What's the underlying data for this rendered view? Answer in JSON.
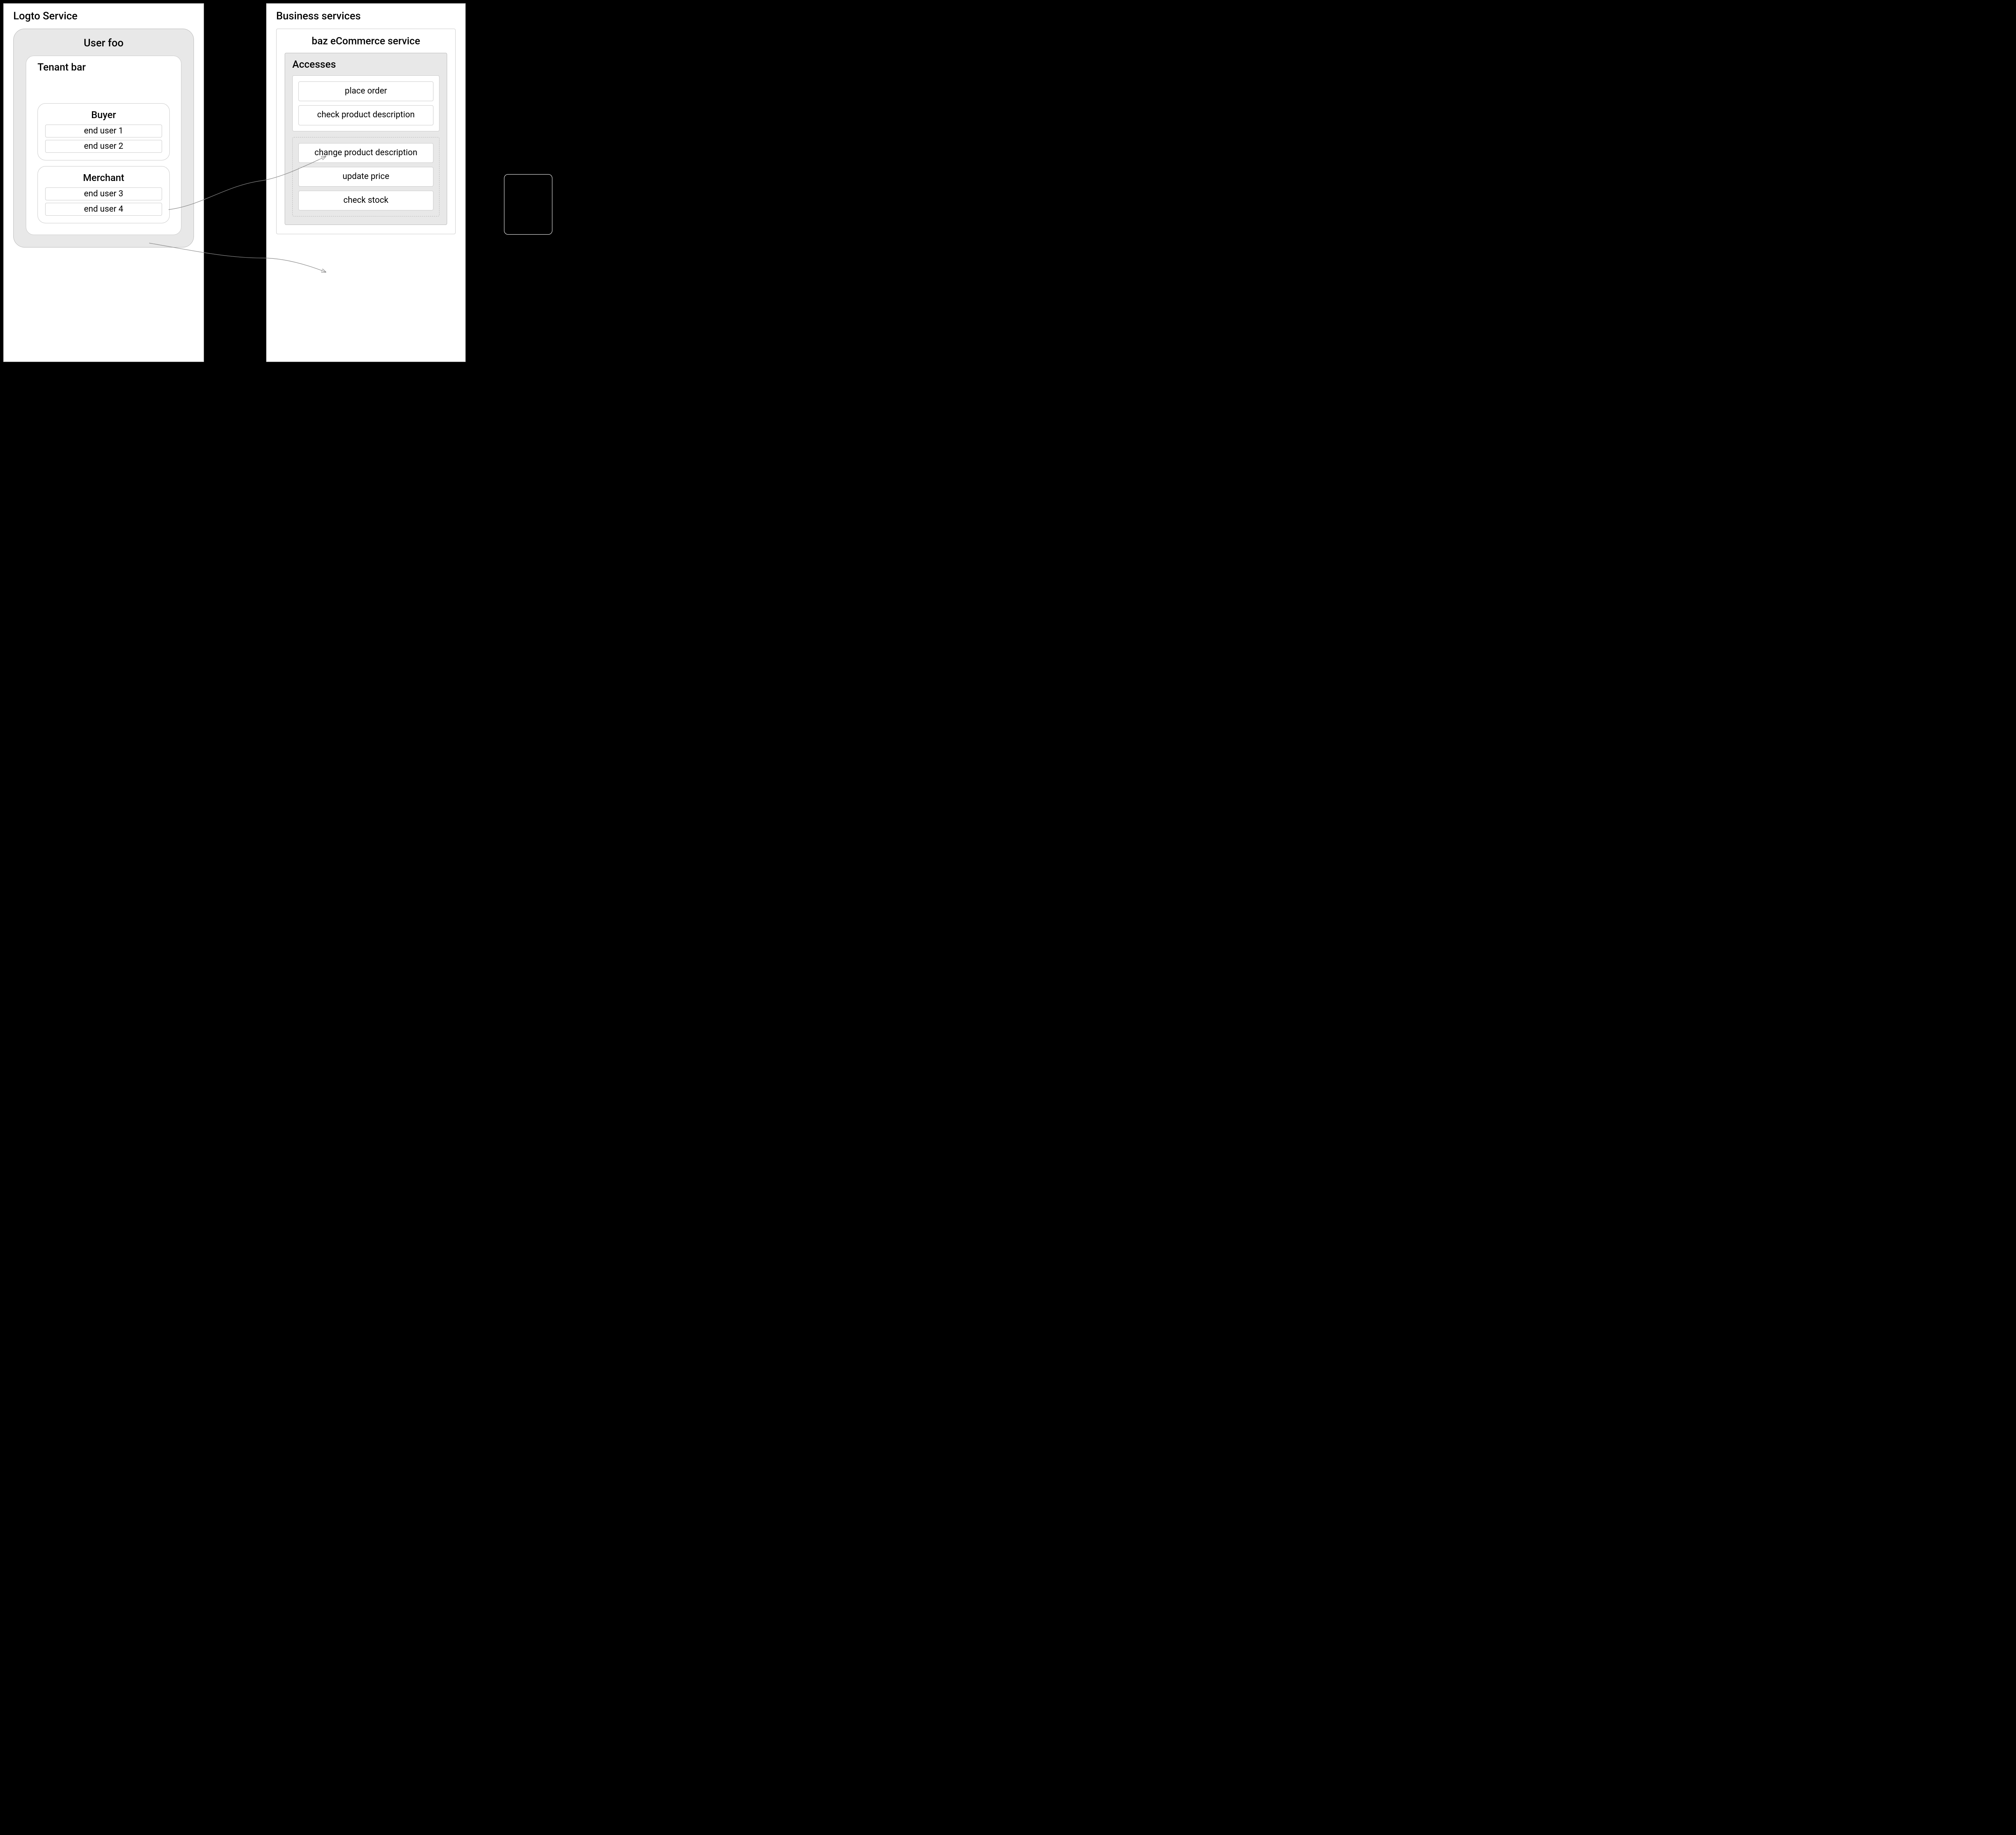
{
  "left_panel": {
    "title": "Logto Service",
    "user": {
      "title": "User foo",
      "tenant": {
        "title": "Tenant bar",
        "roles": [
          {
            "title": "Buyer",
            "users": [
              "end user 1",
              "end user 2"
            ]
          },
          {
            "title": "Merchant",
            "users": [
              "end user 3",
              "end user 4"
            ]
          }
        ]
      }
    }
  },
  "right_panel": {
    "title": "Business services",
    "service": {
      "title": "baz eCommerce service",
      "accesses": {
        "title": "Accesses",
        "group1": [
          "place order",
          "check product description"
        ],
        "group2": [
          "change product description",
          "update price",
          "check stock"
        ]
      }
    }
  },
  "arrows": [
    {
      "from": "buyer-role",
      "to": "access-group-1"
    },
    {
      "from": "merchant-role",
      "to": "access-group-2"
    }
  ]
}
